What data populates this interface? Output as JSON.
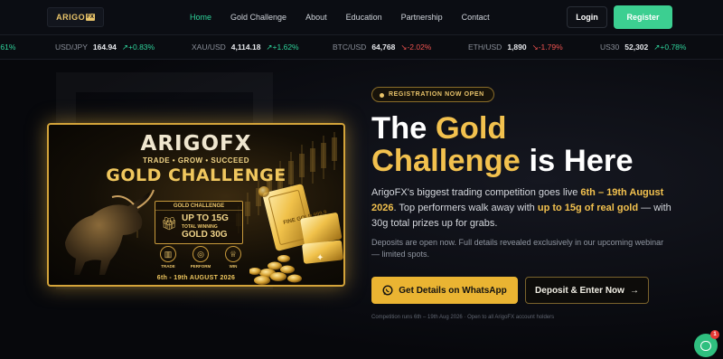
{
  "brand": {
    "logo_text": "ARIGO",
    "logo_badge": "FX"
  },
  "nav": {
    "links": [
      {
        "label": "Home",
        "active": true
      },
      {
        "label": "Gold Challenge",
        "active": false
      },
      {
        "label": "About",
        "active": false
      },
      {
        "label": "Education",
        "active": false
      },
      {
        "label": "Partnership",
        "active": false
      },
      {
        "label": "Contact",
        "active": false
      }
    ],
    "login_label": "Login",
    "register_label": "Register"
  },
  "ticker": [
    {
      "symbol": "",
      "price": "",
      "change": ".61%",
      "dir": "up",
      "arrow": ""
    },
    {
      "symbol": "USD/JPY",
      "price": "164.94",
      "change": "+0.83%",
      "dir": "up",
      "arrow": "↗"
    },
    {
      "symbol": "XAU/USD",
      "price": "4,114.18",
      "change": "+1.62%",
      "dir": "up",
      "arrow": "↗"
    },
    {
      "symbol": "BTC/USD",
      "price": "64,768",
      "change": "-2.02%",
      "dir": "down",
      "arrow": "↘"
    },
    {
      "symbol": "ETH/USD",
      "price": "1,890",
      "change": "-1.79%",
      "dir": "down",
      "arrow": "↘"
    },
    {
      "symbol": "US30",
      "price": "52,302",
      "change": "+0.78%",
      "dir": "up",
      "arrow": "↗"
    }
  ],
  "promo": {
    "title": "ARIGOFX",
    "subtitle": "TRADE • GROW • SUCCEED",
    "challenge": "GOLD CHALLENGE",
    "prize_head": "GOLD CHALLENGE",
    "prize_line1": "UP TO 15G",
    "prize_line2": "TOTAL WINNING",
    "prize_line3": "GOLD 30G",
    "icons": [
      {
        "name": "trade-icon",
        "label": "TRADE",
        "glyph": "▥"
      },
      {
        "name": "perform-icon",
        "label": "PERFORM",
        "glyph": "◎"
      },
      {
        "name": "win-icon",
        "label": "WIN",
        "glyph": "♕"
      }
    ],
    "date": "6th - 19th AUGUST 2026",
    "bar_text": "FINE GOLD 999.9"
  },
  "hero": {
    "badge": "REGISTRATION NOW OPEN",
    "headline_1": "The ",
    "headline_2": "Gold",
    "headline_3": "Challenge",
    "headline_4": " is Here",
    "para_a": "ArigoFX's biggest trading competition goes live ",
    "para_b": "6th – 19th August 2026",
    "para_c": ". Top performers walk away with ",
    "para_d": "up to 15g of real gold",
    "para_e": " — with 30g total prizes up for grabs.",
    "para2": "Deposits are open now. Full details revealed exclusively in our upcoming webinar — limited spots.",
    "whatsapp_label": "Get Details on WhatsApp",
    "deposit_label": "Deposit & Enter Now",
    "deposit_arrow": "→",
    "foot": "Competition runs 6th – 19th Aug 2026 · Open to all ArigoFX account holders"
  },
  "chat": {
    "count": "1"
  },
  "colors": {
    "accent_green": "#3ccf91",
    "gold": "#f2c14e",
    "down": "#ef5350"
  }
}
